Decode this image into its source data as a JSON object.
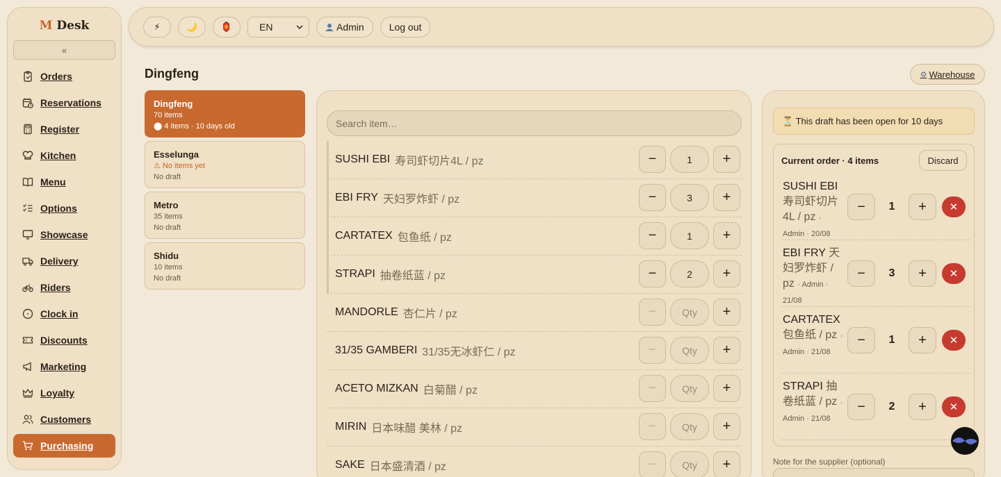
{
  "brand": {
    "logo_m": "M",
    "logo_text": "Desk"
  },
  "sidebar": {
    "collapse_label": "«",
    "items": [
      {
        "label": "Orders",
        "icon": "clipboard-icon"
      },
      {
        "label": "Reservations",
        "icon": "calendar-clock-icon"
      },
      {
        "label": "Register",
        "icon": "calculator-icon"
      },
      {
        "label": "Kitchen",
        "icon": "chef-hat-icon"
      },
      {
        "label": "Menu",
        "icon": "book-open-icon"
      },
      {
        "label": "Options",
        "icon": "list-check-icon"
      },
      {
        "label": "Showcase",
        "icon": "monitor-icon"
      },
      {
        "label": "Delivery",
        "icon": "truck-icon"
      },
      {
        "label": "Riders",
        "icon": "bike-icon"
      },
      {
        "label": "Clock in",
        "icon": "clock-icon"
      },
      {
        "label": "Discounts",
        "icon": "ticket-icon"
      },
      {
        "label": "Marketing",
        "icon": "megaphone-icon"
      },
      {
        "label": "Loyalty",
        "icon": "crown-icon"
      },
      {
        "label": "Customers",
        "icon": "users-icon"
      },
      {
        "label": "Purchasing",
        "icon": "cart-icon",
        "active": true
      }
    ]
  },
  "topbar": {
    "quick_icon": "⚡",
    "theme_icon": "🌙",
    "lantern_icon": "🏮",
    "language": "EN",
    "user_label": "Admin",
    "logout_label": "Log out"
  },
  "page": {
    "title": "Dingfeng",
    "warehouse_label": "Warehouse"
  },
  "suppliers": [
    {
      "name": "Dingfeng",
      "line1": "70 items",
      "line2": "⬤ 4 items · 10 days old",
      "active": true
    },
    {
      "name": "Esselunga",
      "line1": "⚠ No items yet",
      "line2": "No draft",
      "warn": true
    },
    {
      "name": "Metro",
      "line1": "35 items",
      "line2": "No draft"
    },
    {
      "name": "Shidu",
      "line1": "10 items",
      "line2": "No draft"
    }
  ],
  "items": {
    "search_placeholder": "Search item…",
    "rows": [
      {
        "name": "SUSHI EBI",
        "sub": "寿司虾切片4L / pz",
        "qty": "1"
      },
      {
        "name": "EBI FRY",
        "sub": "天妇罗炸虾 / pz",
        "qty": "3"
      },
      {
        "name": "CARTATEX",
        "sub": "包鱼纸 / pz",
        "qty": "1"
      },
      {
        "name": "STRAPI",
        "sub": "抽卷纸蓝 / pz",
        "qty": "2"
      },
      {
        "name": "MANDORLE",
        "sub": "杏仁片 / pz",
        "qty": "Qty"
      },
      {
        "name": "31/35 GAMBERI",
        "sub": "31/35无冰虾仁 / pz",
        "qty": "Qty"
      },
      {
        "name": "ACETO MIZKAN",
        "sub": "白菊醋 / pz",
        "qty": "Qty"
      },
      {
        "name": "MIRIN",
        "sub": "日本味醋 美林 / pz",
        "qty": "Qty"
      },
      {
        "name": "SAKE",
        "sub": "日本盛清酒 / pz",
        "qty": "Qty"
      }
    ],
    "minus": "−",
    "plus": "+"
  },
  "order": {
    "draft_notice": "⏳ This draft has been open for 10 days",
    "head": "Current order · 4 items",
    "discard_label": "Discard",
    "lines": [
      {
        "name": "SUSHI EBI",
        "sub": "寿司虾切片4L / pz",
        "meta": "· Admin · 20/08",
        "qty": "1"
      },
      {
        "name": "EBI FRY",
        "sub": "天妇罗炸虾 / pz",
        "meta": "· Admin · 21/08",
        "qty": "3"
      },
      {
        "name": "CARTATEX",
        "sub": "包鱼纸 / pz",
        "meta": "· Admin · 21/08",
        "qty": "1"
      },
      {
        "name": "STRAPI",
        "sub": "抽卷纸蓝 / pz",
        "meta": "· Admin · 21/08",
        "qty": "2"
      }
    ],
    "remove_glyph": "✕",
    "note_label": "Note for the supplier (optional)"
  }
}
